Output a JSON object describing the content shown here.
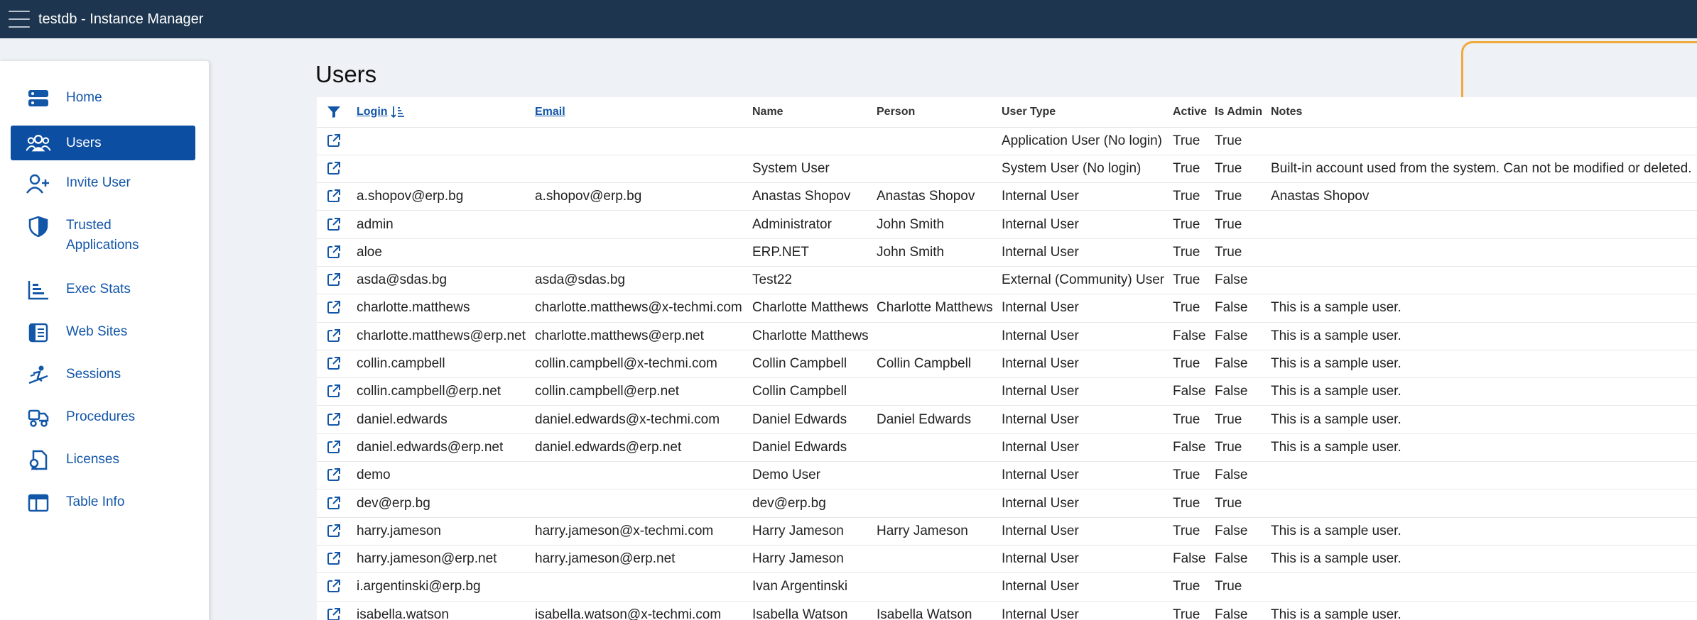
{
  "header": {
    "title": "testdb - Instance Manager"
  },
  "sidebar": {
    "items": [
      {
        "label": "Home",
        "icon": "home-icon"
      },
      {
        "label": "Users",
        "icon": "users-icon",
        "active": true
      },
      {
        "label": "Invite User",
        "icon": "invite-user-icon"
      },
      {
        "label": "Trusted\nApplications",
        "line1": "Trusted",
        "line2": "Applications",
        "icon": "shield-icon"
      },
      {
        "label": "Exec Stats",
        "icon": "bar-chart-icon"
      },
      {
        "label": "Web Sites",
        "icon": "web-sites-icon"
      },
      {
        "label": "Sessions",
        "icon": "sessions-icon"
      },
      {
        "label": "Procedures",
        "icon": "procedures-icon"
      },
      {
        "label": "Licenses",
        "icon": "licenses-icon"
      },
      {
        "label": "Table Info",
        "icon": "table-info-icon"
      }
    ]
  },
  "page": {
    "title": "Users"
  },
  "table": {
    "columns": [
      "Login",
      "Email",
      "Name",
      "Person",
      "User Type",
      "Active",
      "Is Admin",
      "Notes"
    ],
    "rows": [
      [
        "",
        "",
        "",
        "",
        "Application User (No login)",
        "True",
        "True",
        ""
      ],
      [
        "",
        "",
        "System User",
        "",
        "System User (No login)",
        "True",
        "True",
        "Built-in account used from the system. Can not be modified or deleted."
      ],
      [
        "a.shopov@erp.bg",
        "a.shopov@erp.bg",
        "Anastas Shopov",
        "Anastas Shopov",
        "Internal User",
        "True",
        "True",
        "Anastas Shopov"
      ],
      [
        "admin",
        "",
        "Administrator",
        "John Smith",
        "Internal User",
        "True",
        "True",
        ""
      ],
      [
        "aloe",
        "",
        "ERP.NET",
        "John Smith",
        "Internal User",
        "True",
        "True",
        ""
      ],
      [
        "asda@sdas.bg",
        "asda@sdas.bg",
        "Test22",
        "",
        "External (Community) User",
        "True",
        "False",
        ""
      ],
      [
        "charlotte.matthews",
        "charlotte.matthews@x-techmi.com",
        "Charlotte Matthews",
        "Charlotte Matthews",
        "Internal User",
        "True",
        "False",
        "This is a sample user."
      ],
      [
        "charlotte.matthews@erp.net",
        "charlotte.matthews@erp.net",
        "Charlotte Matthews",
        "",
        "Internal User",
        "False",
        "False",
        "This is a sample user."
      ],
      [
        "collin.campbell",
        "collin.campbell@x-techmi.com",
        "Collin Campbell",
        "Collin Campbell",
        "Internal User",
        "True",
        "False",
        "This is a sample user."
      ],
      [
        "collin.campbell@erp.net",
        "collin.campbell@erp.net",
        "Collin Campbell",
        "",
        "Internal User",
        "False",
        "False",
        "This is a sample user."
      ],
      [
        "daniel.edwards",
        "daniel.edwards@x-techmi.com",
        "Daniel Edwards",
        "Daniel Edwards",
        "Internal User",
        "True",
        "True",
        "This is a sample user."
      ],
      [
        "daniel.edwards@erp.net",
        "daniel.edwards@erp.net",
        "Daniel Edwards",
        "",
        "Internal User",
        "False",
        "True",
        "This is a sample user."
      ],
      [
        "demo",
        "",
        "Demo User",
        "",
        "Internal User",
        "True",
        "False",
        ""
      ],
      [
        "dev@erp.bg",
        "",
        "dev@erp.bg",
        "",
        "Internal User",
        "True",
        "True",
        ""
      ],
      [
        "harry.jameson",
        "harry.jameson@x-techmi.com",
        "Harry Jameson",
        "Harry Jameson",
        "Internal User",
        "True",
        "False",
        "This is a sample user."
      ],
      [
        "harry.jameson@erp.net",
        "harry.jameson@erp.net",
        "Harry Jameson",
        "",
        "Internal User",
        "False",
        "False",
        "This is a sample user."
      ],
      [
        "i.argentinski@erp.bg",
        "",
        "Ivan Argentinski",
        "",
        "Internal User",
        "True",
        "True",
        ""
      ],
      [
        "isabella.watson",
        "isabella.watson@x-techmi.com",
        "Isabella Watson",
        "Isabella Watson",
        "Internal User",
        "True",
        "False",
        "This is a sample user."
      ]
    ]
  },
  "colors": {
    "topbar": "#1d354f",
    "accent": "#0c4ea2",
    "link": "#1256a8",
    "highlight": "#f0a93a"
  }
}
